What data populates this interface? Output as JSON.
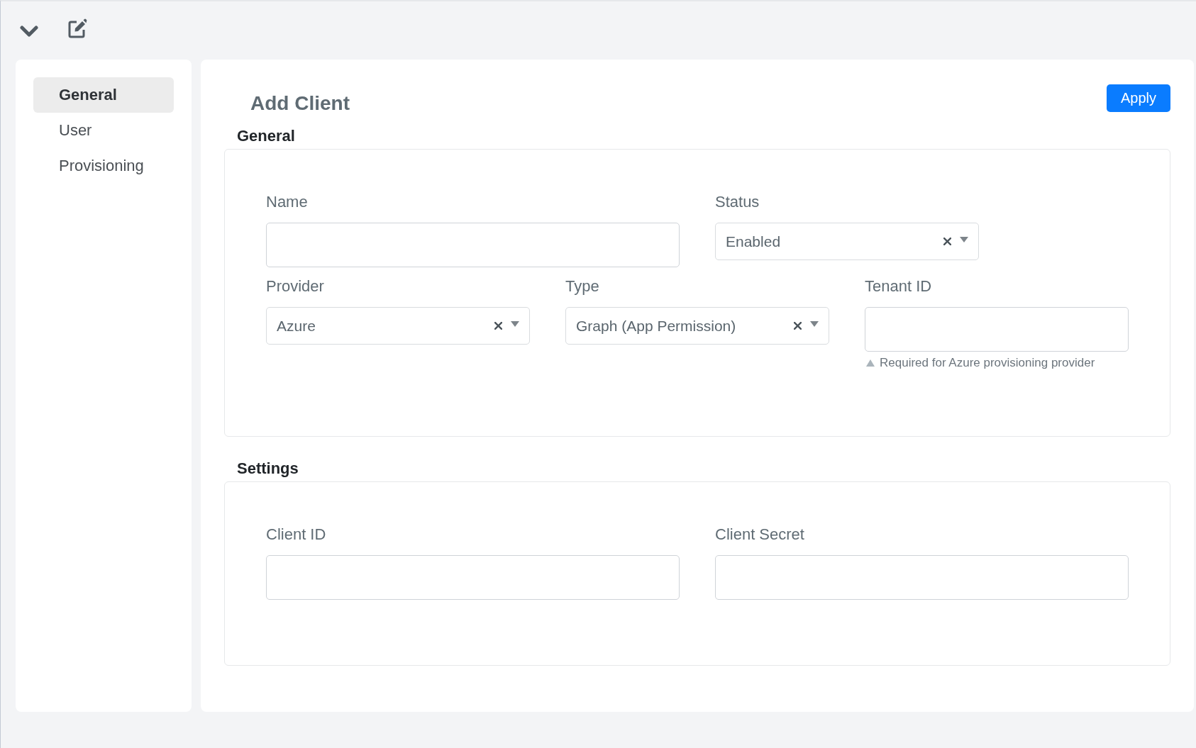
{
  "sidebar": {
    "items": [
      {
        "label": "General",
        "selected": true
      },
      {
        "label": "User",
        "selected": false
      },
      {
        "label": "Provisioning",
        "selected": false
      }
    ]
  },
  "header": {
    "title": "Add Client",
    "apply_button": "Apply"
  },
  "sections": [
    {
      "heading": "General",
      "rows": [
        [
          {
            "kind": "text",
            "label": "Name"
          },
          {
            "kind": "select",
            "label": "Status",
            "value": "Enabled"
          }
        ],
        [
          {
            "kind": "select",
            "label": "Provider",
            "value": "Azure"
          },
          {
            "kind": "select",
            "label": "Type",
            "value": "Graph (App Permission)"
          },
          {
            "kind": "text",
            "label": "Tenant ID",
            "hint": "Required for Azure provisioning provider"
          }
        ]
      ]
    },
    {
      "heading": "Settings",
      "rows": [
        [
          {
            "kind": "text",
            "label": "Client ID"
          },
          {
            "kind": "text",
            "label": "Client Secret"
          }
        ]
      ]
    }
  ]
}
